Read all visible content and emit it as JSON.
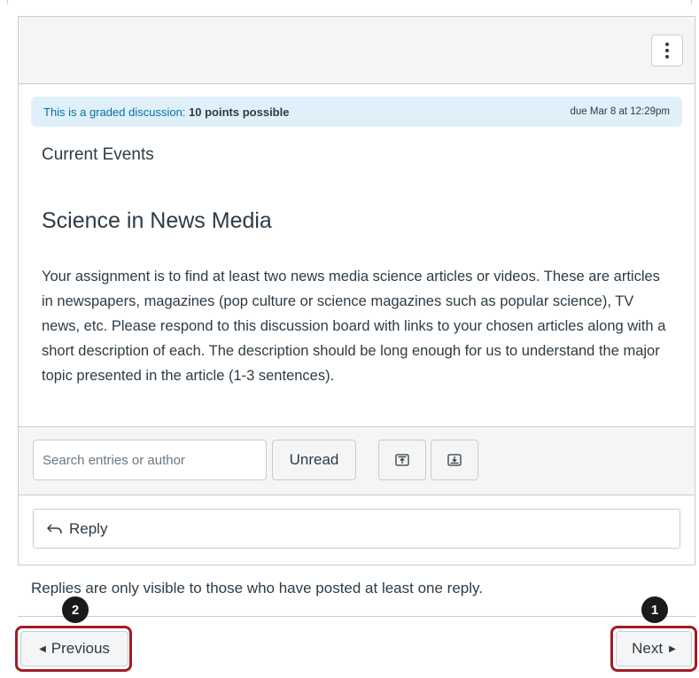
{
  "discussion": {
    "graded_label": "This is a graded discussion:",
    "points_text": "10 points possible",
    "due_text": "due Mar 8 at 12:29pm",
    "topic": "Current Events",
    "heading": "Science in News Media",
    "body": "Your assignment is to find at least two news media science articles or videos.  These are articles in newspapers, magazines (pop culture or science magazines such as popular science), TV news, etc.  Please respond to this discussion board with links to your chosen articles along with a short description of each.  The description should be long enough for us to understand the major topic presented in the article (1-3 sentences)."
  },
  "toolbar": {
    "search_placeholder": "Search entries or author",
    "unread_label": "Unread"
  },
  "reply": {
    "label": "Reply"
  },
  "replies_note": "Replies are only visible to those who have posted at least one reply.",
  "navigation": {
    "previous_label": "Previous",
    "next_label": "Next"
  },
  "annotations": {
    "marker_next": "1",
    "marker_previous": "2"
  },
  "colors": {
    "banner_bg": "#e0f0fa",
    "banner_label": "#0770a3",
    "highlight": "#a31c23",
    "marker": "#1a1a1a"
  },
  "icons": {
    "kebab": "more-options-icon",
    "collapse": "collapse-all-icon",
    "expand": "expand-all-icon",
    "reply": "reply-arrow-icon",
    "prev_caret": "caret-left-icon",
    "next_caret": "caret-right-icon"
  }
}
